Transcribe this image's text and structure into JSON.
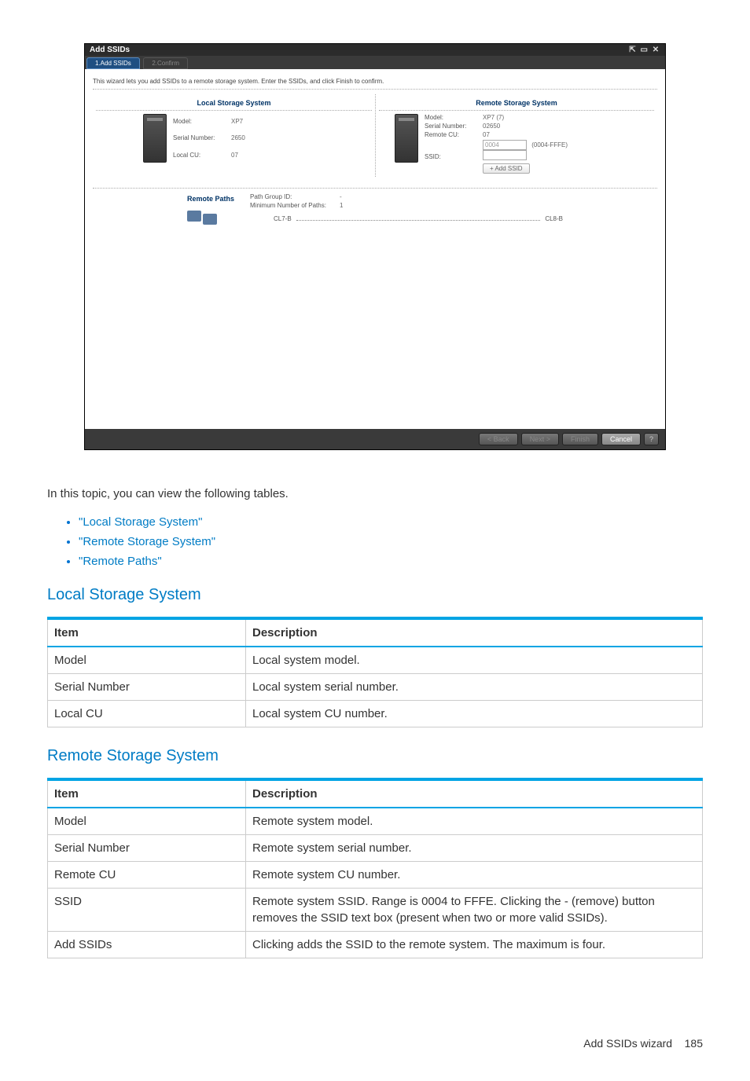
{
  "wizard": {
    "title": "Add SSIDs",
    "tabs": [
      {
        "label": "1.Add SSIDs",
        "active": true
      },
      {
        "label": "2.Confirm",
        "active": false
      }
    ],
    "instruction": "This wizard lets you add SSIDs to a remote storage system. Enter the SSIDs, and click Finish to confirm.",
    "local": {
      "heading": "Local Storage System",
      "fields": {
        "model_label": "Model:",
        "model_value": "XP7",
        "serial_label": "Serial Number:",
        "serial_value": "2650",
        "cu_label": "Local CU:",
        "cu_value": "07"
      }
    },
    "remote": {
      "heading": "Remote Storage System",
      "fields": {
        "model_label": "Model:",
        "model_value": "XP7 (7)",
        "serial_label": "Serial Number:",
        "serial_value": "02650",
        "cu_label": "Remote CU:",
        "cu_value": "07",
        "ssid_label": "SSID:",
        "ssid_value": "0004",
        "ssid_range": "(0004-FFFE)",
        "add_button": "+ Add SSID"
      }
    },
    "remote_paths": {
      "heading": "Remote Paths",
      "pg_label": "Path Group ID:",
      "pg_value": "-",
      "min_label": "Minimum Number of Paths:",
      "min_value": "1",
      "port_left": "CL7-B",
      "port_right": "CL8-B"
    },
    "footer": {
      "back": "< Back",
      "next": "Next >",
      "finish": "Finish",
      "cancel": "Cancel",
      "help": "?"
    }
  },
  "doc": {
    "intro": "In this topic, you can view the following tables.",
    "links": [
      "\"Local Storage System\"",
      "\"Remote Storage System\"",
      "\"Remote Paths\""
    ],
    "sections": [
      {
        "heading": "Local Storage System",
        "header_item": "Item",
        "header_desc": "Description",
        "rows": [
          {
            "item": "Model",
            "desc": "Local system model."
          },
          {
            "item": "Serial Number",
            "desc": "Local system serial number."
          },
          {
            "item": "Local CU",
            "desc": "Local system CU number."
          }
        ]
      },
      {
        "heading": "Remote Storage System",
        "header_item": "Item",
        "header_desc": "Description",
        "rows": [
          {
            "item": "Model",
            "desc": "Remote system model."
          },
          {
            "item": "Serial Number",
            "desc": "Remote system serial number."
          },
          {
            "item": "Remote CU",
            "desc": "Remote system CU number."
          },
          {
            "item": "SSID",
            "desc": "Remote system SSID. Range is 0004 to FFFE. Clicking the - (remove) button removes the SSID text box (present when two or more valid SSIDs)."
          },
          {
            "item": "Add SSIDs",
            "desc": "Clicking adds the SSID to the remote system. The maximum is four."
          }
        ]
      }
    ],
    "footer_text": "Add SSIDs wizard",
    "footer_page": "185"
  }
}
